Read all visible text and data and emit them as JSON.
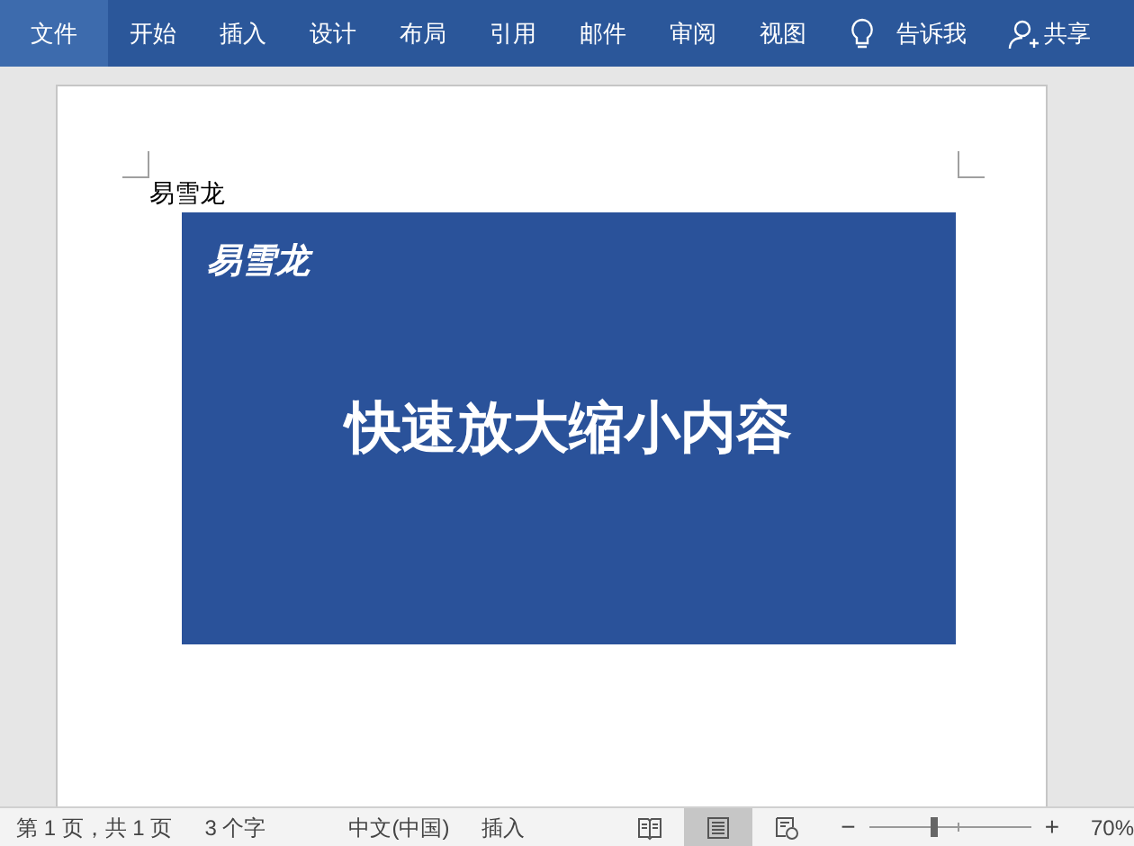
{
  "ribbon": {
    "tabs": [
      {
        "label": "文件",
        "selected": true
      },
      {
        "label": "开始",
        "selected": false
      },
      {
        "label": "插入",
        "selected": false
      },
      {
        "label": "设计",
        "selected": false
      },
      {
        "label": "布局",
        "selected": false
      },
      {
        "label": "引用",
        "selected": false
      },
      {
        "label": "邮件",
        "selected": false
      },
      {
        "label": "审阅",
        "selected": false
      },
      {
        "label": "视图",
        "selected": false
      }
    ],
    "tell_me": "告诉我",
    "share": "共享"
  },
  "document": {
    "text": "易雪龙",
    "slide": {
      "logo": "易雪龙",
      "title": "快速放大缩小内容"
    }
  },
  "status_bar": {
    "page": "第 1 页，共 1 页",
    "words": "3 个字",
    "language": "中文(中国)",
    "mode": "插入",
    "views": [
      {
        "kind": "read",
        "selected": false
      },
      {
        "kind": "print",
        "selected": true
      },
      {
        "kind": "web",
        "selected": false
      }
    ],
    "zoom": {
      "minus": "−",
      "plus": "+",
      "level": 0.36,
      "reading": "70%"
    }
  }
}
